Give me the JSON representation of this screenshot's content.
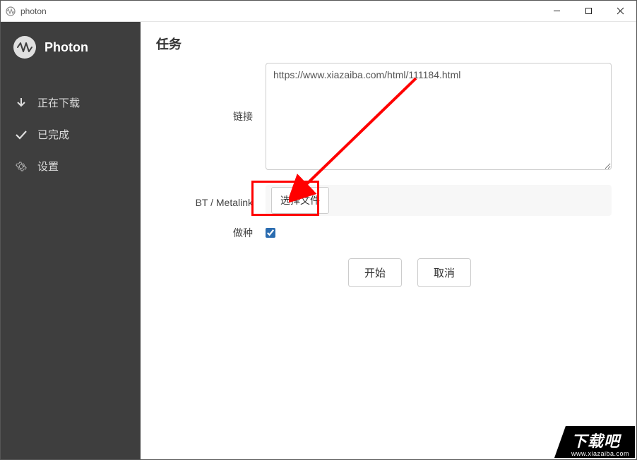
{
  "window": {
    "title": "photon"
  },
  "brand": {
    "name": "Photon"
  },
  "sidebar": {
    "items": [
      {
        "label": "正在下载"
      },
      {
        "label": "已完成"
      },
      {
        "label": "设置"
      }
    ]
  },
  "page": {
    "title": "任务"
  },
  "form": {
    "link_label": "链接",
    "url_value": "https://www.xiazaiba.com/html/111184.html",
    "bt_label": "BT / Metalink",
    "choose_file_label": "选择文件",
    "seed_label": "做种",
    "seed_checked": true
  },
  "actions": {
    "start": "开始",
    "cancel": "取消"
  },
  "watermark": {
    "main": "下载吧",
    "sub": "www.xiazaiba.com"
  }
}
